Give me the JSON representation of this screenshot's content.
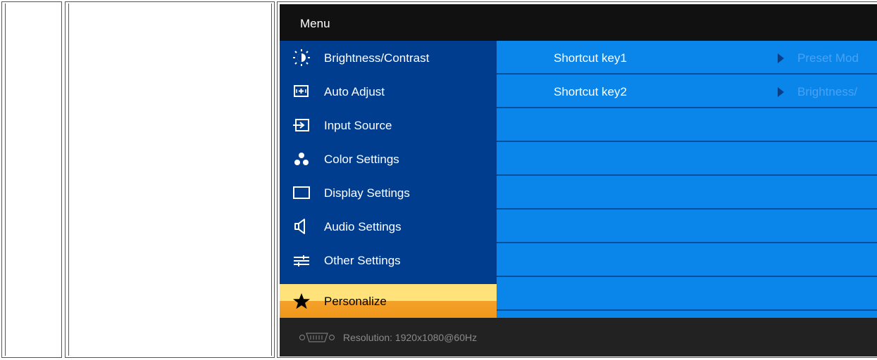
{
  "osd": {
    "title": "Menu",
    "menu": [
      {
        "label": "Brightness/Contrast",
        "icon": "brightness-icon"
      },
      {
        "label": "Auto Adjust",
        "icon": "auto-adjust-icon"
      },
      {
        "label": "Input Source",
        "icon": "input-source-icon"
      },
      {
        "label": "Color Settings",
        "icon": "color-settings-icon"
      },
      {
        "label": "Display Settings",
        "icon": "display-settings-icon"
      },
      {
        "label": "Audio Settings",
        "icon": "audio-settings-icon"
      },
      {
        "label": "Other Settings",
        "icon": "other-settings-icon"
      },
      {
        "label": "Personalize",
        "icon": "star-icon",
        "selected": true
      }
    ],
    "submenu": [
      {
        "label": "Shortcut key1",
        "value": "Preset Mod"
      },
      {
        "label": "Shortcut key2",
        "value": "Brightness/"
      }
    ],
    "footer": {
      "resolution": "Resolution:  1920x1080@60Hz",
      "icon": "vga-connector-icon"
    },
    "colors": {
      "menu_bg": "#003d8f",
      "panel_bg": "#0a85ea",
      "selected_top": "#ffe37a",
      "selected_bottom": "#f4a22b"
    }
  }
}
